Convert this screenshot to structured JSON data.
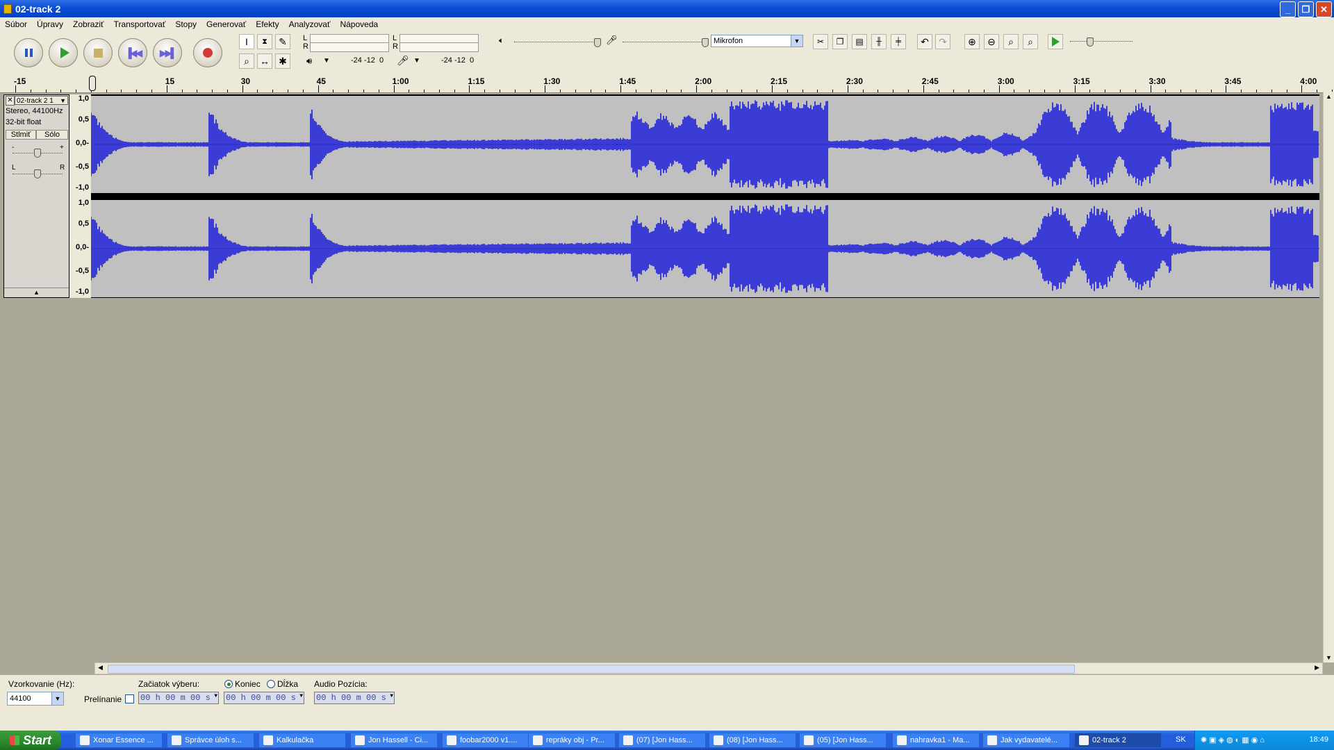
{
  "window": {
    "title": "02-track 2",
    "minimize": "_",
    "maximize": "❐",
    "close": "✕"
  },
  "menu": [
    "Súbor",
    "Úpravy",
    "Zobraziť",
    "Transportovať",
    "Stopy",
    "Generovať",
    "Efekty",
    "Analyzovať",
    "Nápoveda"
  ],
  "meters": {
    "left": "L",
    "right": "R",
    "scale_play": "-24 -12  0",
    "scale_rec": "-24 -12  0"
  },
  "mixer": {
    "input_source": "Mikrofon"
  },
  "ruler": {
    "labels": [
      "-15",
      "0",
      "15",
      "30",
      "45",
      "1:00",
      "1:15",
      "1:30",
      "1:45",
      "2:00",
      "2:15",
      "2:30",
      "2:45",
      "3:00",
      "3:15",
      "3:30",
      "3:45",
      "4:00"
    ]
  },
  "track": {
    "name": "02-track 2 1",
    "format": "Stereo, 44100Hz",
    "bits": "32-bit float",
    "mute": "Stlmiť",
    "solo": "Sólo",
    "gain_minus": "-",
    "gain_plus": "+",
    "pan_left": "L",
    "pan_right": "R",
    "collapse": "▲",
    "scale": [
      "1,0",
      "0,5",
      "0,0-",
      "-0,5",
      "-1,0"
    ]
  },
  "bottom": {
    "rate_label": "Vzorkovanie (Hz):",
    "rate_value": "44100",
    "snap_label": "Prelínanie",
    "sel_start_label": "Začiatok výberu:",
    "end_label": "Koniec",
    "length_label": "Dĺžka",
    "audio_pos_label": "Audio Pozícia:",
    "time1": "00 h 00 m 00 s",
    "time2": "00 h 00 m 00 s",
    "time3": "00 h 00 m 00 s"
  },
  "taskbar": {
    "start": "Start",
    "tasks": [
      "Xonar Essence ...",
      "Správce úloh s...",
      "Kalkulačka",
      "Jon Hassell - Ci...",
      "foobar2000 v1....",
      "repráky obj - Pr...",
      "(07) [Jon Hass...",
      "(08) [Jon Hass...",
      "(05) [Jon Hass...",
      "nahravka1 - Ma...",
      "Jak vydavatelé...",
      "02-track 2"
    ],
    "lang": "SK",
    "clock": "18:49"
  },
  "colors": {
    "waveform": "#3b3bd6",
    "waveform_bg": "#c0c0c0",
    "workspace": "#aba898"
  }
}
